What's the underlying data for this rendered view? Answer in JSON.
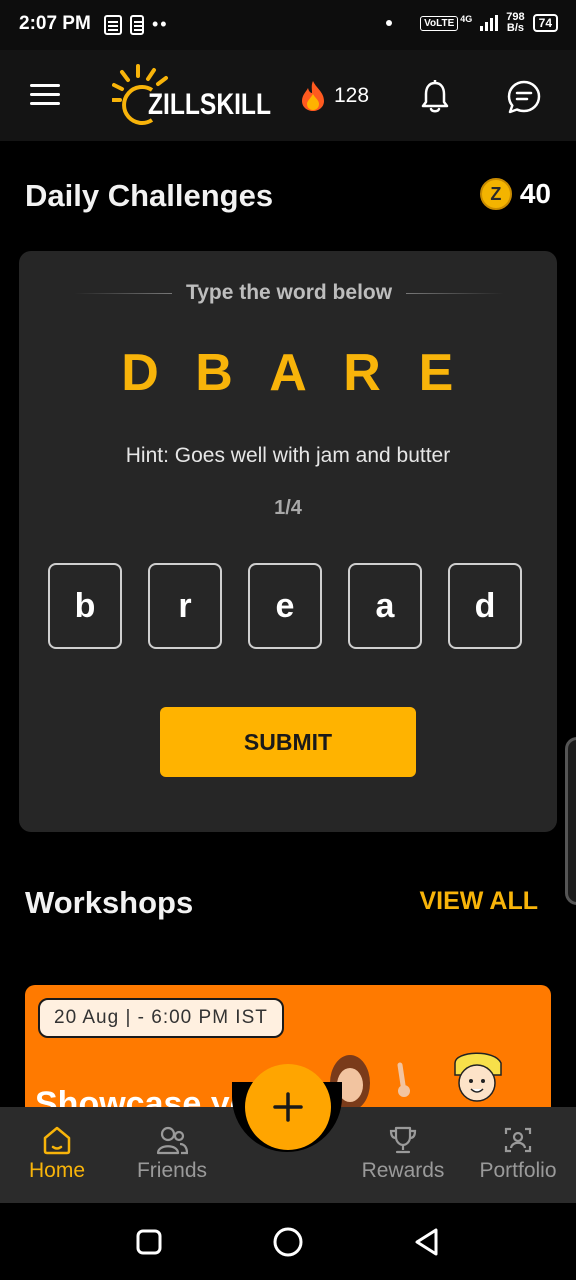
{
  "status_bar": {
    "time": "2:07 PM",
    "network": "VoLTE",
    "network_gen": "4G",
    "speed_value": "798",
    "speed_unit": "B/s",
    "battery": "74"
  },
  "header": {
    "logo_text": "ZILLSKILL",
    "streak_count": "128",
    "icons": [
      "menu-icon",
      "fire-icon",
      "bell-icon",
      "chat-icon"
    ]
  },
  "daily": {
    "title": "Daily Challenges",
    "coins": "40",
    "coin_symbol": "Z",
    "instruction": "Type the word below",
    "scrambled": [
      "D",
      "B",
      "A",
      "R",
      "E"
    ],
    "hint": "Hint: Goes well with jam and butter",
    "progress": "1/4",
    "answer_letters": [
      "b",
      "r",
      "e",
      "a",
      "d"
    ],
    "submit_label": "SUBMIT"
  },
  "workshops": {
    "title": "Workshops",
    "view_all": "VIEW ALL",
    "card": {
      "date": "20 Aug | - 6:00 PM IST",
      "title": "Showcase yo"
    }
  },
  "bottom_nav": {
    "items": [
      {
        "label": "Home",
        "icon": "home-icon",
        "active": true
      },
      {
        "label": "Friends",
        "icon": "friends-icon",
        "active": false
      },
      {
        "label": "Rewards",
        "icon": "trophy-icon",
        "active": false
      },
      {
        "label": "Portfolio",
        "icon": "portfolio-icon",
        "active": false
      }
    ],
    "fab_icon": "plus-icon"
  },
  "colors": {
    "accent": "#f8b40a",
    "button": "#ffb300",
    "card": "#262626",
    "workshop": "#ff7a00"
  }
}
